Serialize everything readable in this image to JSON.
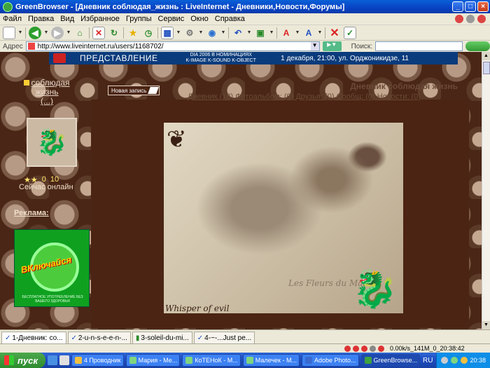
{
  "window": {
    "title": "GreenBrowser - [Дневник соблюдая_жизнь : LiveInternet - Дневники,Новости,Форумы]",
    "buttons": [
      "_",
      "□",
      "×"
    ]
  },
  "menu": {
    "items": [
      "Файл",
      "Правка",
      "Вид",
      "Избранное",
      "Группы",
      "Сервис",
      "Окно",
      "Справка"
    ]
  },
  "address": {
    "label": "Адрес",
    "url": "http://www.liveinternet.ru/users/1168702/",
    "search_label": "Поиск:"
  },
  "banner": {
    "left": "ПРЕДСТАВЛЕНИЕ",
    "mid_line1": "DIA 2006 В НОМИНАЦИЯХ",
    "mid_line2": "K-IMAGE K-SOUND K-OBJECT",
    "right": "1 декабря, 21:00, ул. Орджоникидзе, 11"
  },
  "sidebar": {
    "username": "соблюдая жизнь",
    "username_more": "(...)",
    "status_count1": "0",
    "status_count2": "10",
    "online": "Сейчас онлайн",
    "ads_label": "Реклама:",
    "ad_text": "ВКлючайся",
    "ad_small": "БЕСПЛАТНОЕ УПОТРЕБЛЕНИЕ БЕЗ ВАШЕГО ЗДОРОВЬЯ"
  },
  "main": {
    "new_post": "Новая запись",
    "diary_title": "Дневник соблюдая жизнь",
    "links": "Дневник (18) Фотоальбом: (0) Друзья: (0) Сообщ: (0) Новости: (0)",
    "image_caption1": "Les Fleurs du Mal",
    "image_caption2": "Whisper of evil"
  },
  "tabs": [
    {
      "label": "1-Дневник: со..."
    },
    {
      "label": "2-u-n-s-e-e-n-..."
    },
    {
      "label": "3-soleil-du-mi..."
    },
    {
      "label": "4-~-...Just pe..."
    }
  ],
  "status": {
    "text": "0.00k/s_141M_0_20:38:42"
  },
  "taskbar": {
    "start": "пуск",
    "tasks": [
      {
        "label": "4 Проводник",
        "color": "#f0c040"
      },
      {
        "label": "Мария - Ме...",
        "color": "#7fd57f"
      },
      {
        "label": "КоТЕНоК - М...",
        "color": "#7fd57f"
      },
      {
        "label": "Малечек - М...",
        "color": "#7fd57f"
      },
      {
        "label": "Adobe Photo...",
        "color": "#3a6ad0"
      },
      {
        "label": "GreenBrowse...",
        "color": "#3fa33f"
      }
    ],
    "lang": "RU",
    "clock": "20:38"
  }
}
